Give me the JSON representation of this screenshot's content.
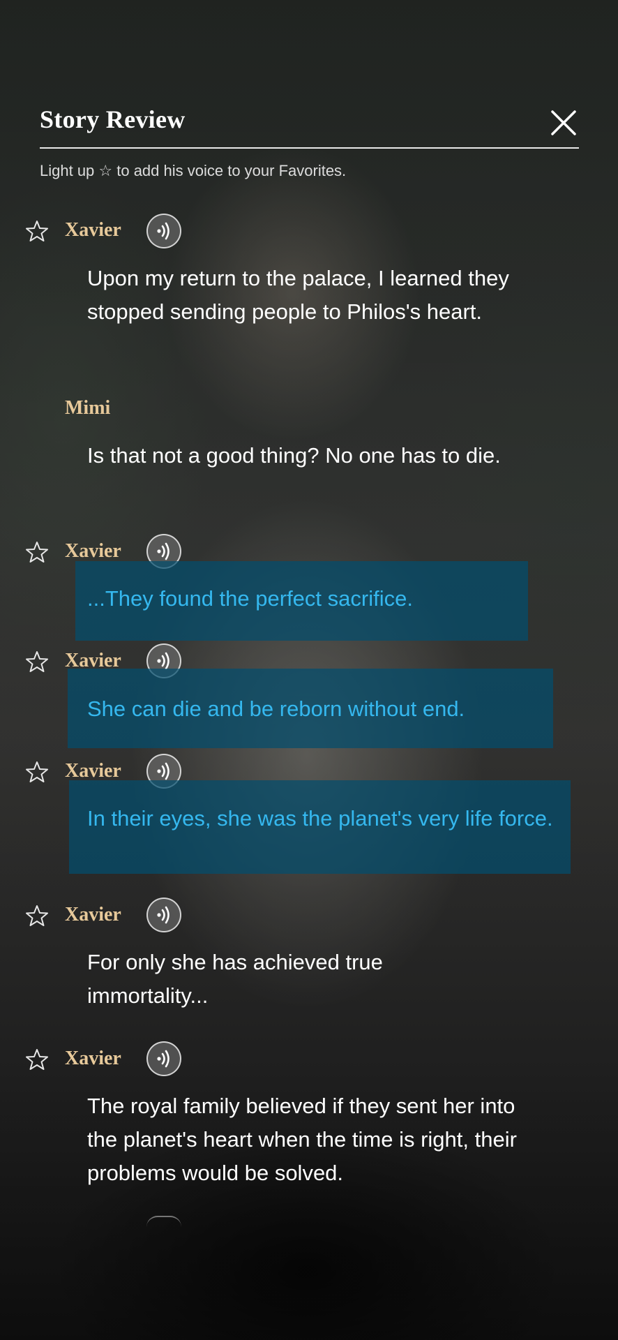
{
  "header": {
    "title": "Story Review",
    "subtitle": "Light up ☆ to add his voice to your Favorites."
  },
  "colors": {
    "speaker": "#e7c99a",
    "highlight_text": "#35b8ef",
    "highlight_bg": "#034e6e"
  },
  "entries": [
    {
      "speaker": "Xavier",
      "has_favorite": true,
      "has_voice": true,
      "highlighted": false,
      "text": "Upon my return to the palace, I learned they stopped sending people to Philos's heart."
    },
    {
      "speaker": "Mimi",
      "has_favorite": false,
      "has_voice": false,
      "highlighted": false,
      "text": "Is that not a good thing? No one has to die."
    },
    {
      "speaker": "Xavier",
      "has_favorite": true,
      "has_voice": true,
      "highlighted": true,
      "text": "...They found the perfect sacrifice."
    },
    {
      "speaker": "Xavier",
      "has_favorite": true,
      "has_voice": true,
      "highlighted": true,
      "text": "She can die and be reborn without end."
    },
    {
      "speaker": "Xavier",
      "has_favorite": true,
      "has_voice": true,
      "highlighted": true,
      "text": "In their eyes, she was the planet's very life force."
    },
    {
      "speaker": "Xavier",
      "has_favorite": true,
      "has_voice": true,
      "highlighted": false,
      "text": "For only she has achieved true immortality..."
    },
    {
      "speaker": "Xavier",
      "has_favorite": true,
      "has_voice": true,
      "highlighted": false,
      "text": "The royal family believed if they sent her into the planet's heart when the time is right, their problems would be solved."
    }
  ]
}
